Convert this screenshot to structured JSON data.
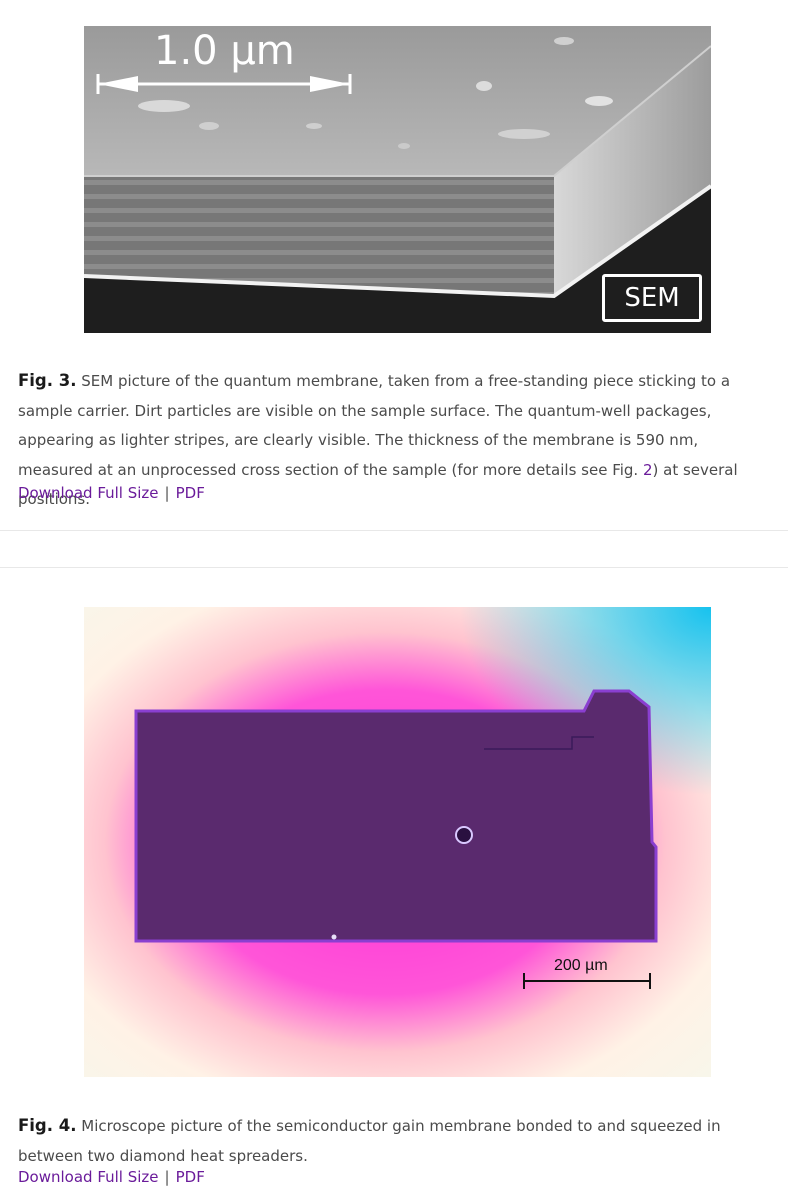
{
  "figures": [
    {
      "label": "Fig. 3.",
      "caption_before_link": " SEM picture of the quantum membrane, taken from a free-standing piece sticking to a sample carrier. Dirt particles are visible on the sample surface. The quantum-well packages, appearing as lighter stripes, are clearly visible. The thickness of the membrane is 590 nm, measured at an unprocessed cross section of the sample (for more details see Fig. ",
      "caption_link": "2",
      "caption_after_link": ") at several positions.",
      "image": {
        "scale_label": "1.0 µm",
        "badge": "SEM",
        "alt_theme": "grayscale"
      },
      "download_label": "Download Full Size",
      "separator": "|",
      "pdf_label": "PDF"
    },
    {
      "label": "Fig. 4.",
      "caption_before_link": " Microscope picture of the semiconductor gain membrane bonded to and squeezed in between two diamond heat spreaders.",
      "caption_link": "",
      "caption_after_link": "",
      "image": {
        "scale_label": "200 µm",
        "colors": {
          "membrane": "#5a2a6e",
          "halo": "#ff3fd2",
          "corner_top_right": "#1ec8f0"
        }
      },
      "download_label": "Download Full Size",
      "separator": "|",
      "pdf_label": "PDF"
    }
  ],
  "colors": {
    "link": "#6a1b9a",
    "text": "#4b4b4b",
    "divider": "#e8e8e8"
  }
}
